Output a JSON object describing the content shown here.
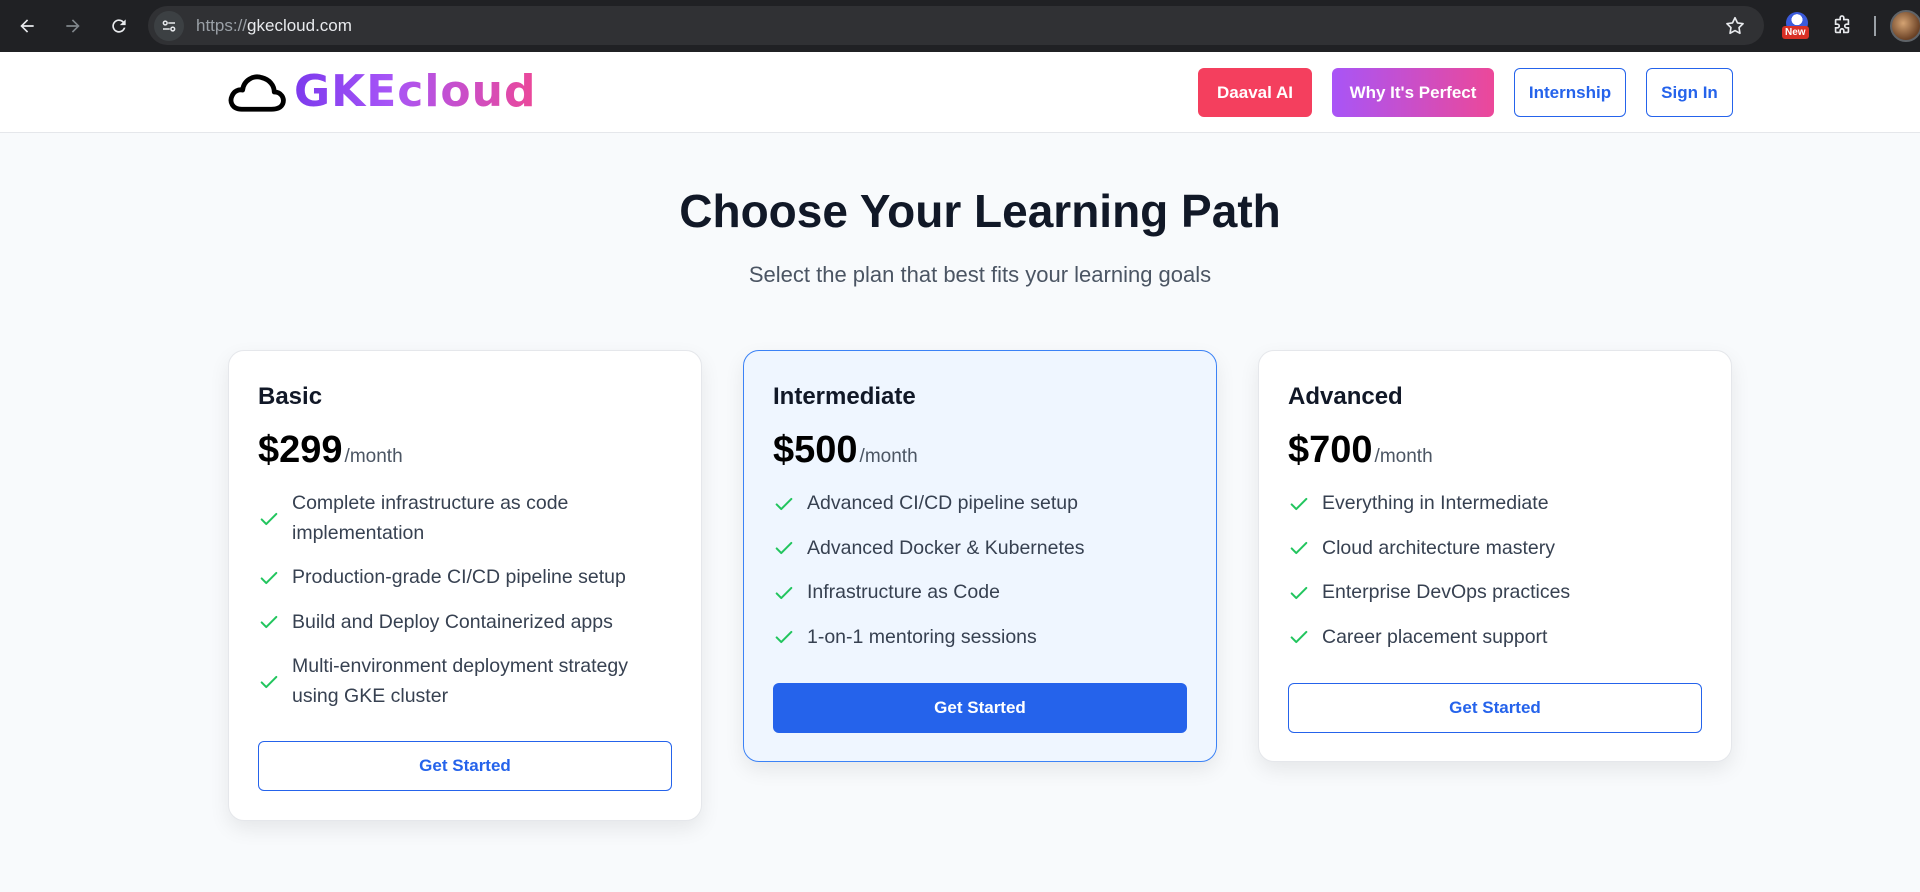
{
  "browser": {
    "url_scheme": "https://",
    "url_host": "gkecloud.com",
    "extension_badge": "New",
    "icons": [
      "back-arrow-icon",
      "forward-arrow-icon",
      "reload-icon",
      "site-settings-icon",
      "bookmark-star-icon",
      "extensions-puzzle-icon"
    ]
  },
  "header": {
    "logo_text": "GKEcloud",
    "buttons": {
      "daaval": "Daaval AI",
      "why": "Why It's Perfect",
      "internship": "Internship",
      "signin": "Sign In"
    }
  },
  "main": {
    "title": "Choose Your Learning Path",
    "subtitle": "Select the plan that best fits your learning goals"
  },
  "plans": [
    {
      "name": "Basic",
      "price": "$299",
      "period": "/month",
      "features": [
        "Complete infrastructure as code implementation",
        "Production-grade CI/CD pipeline setup",
        "Build and Deploy Containerized apps",
        "Multi-environment deployment strategy using GKE cluster"
      ],
      "cta": "Get Started"
    },
    {
      "name": "Intermediate",
      "price": "$500",
      "period": "/month",
      "features": [
        "Advanced CI/CD pipeline setup",
        "Advanced Docker & Kubernetes",
        "Infrastructure as Code",
        "1-on-1 mentoring sessions"
      ],
      "cta": "Get Started"
    },
    {
      "name": "Advanced",
      "price": "$700",
      "period": "/month",
      "features": [
        "Everything in Intermediate",
        "Cloud architecture mastery",
        "Enterprise DevOps practices",
        "Career placement support"
      ],
      "cta": "Get Started"
    }
  ],
  "colors": {
    "primary": "#2563eb",
    "check": "#22c55e",
    "daaval": "#f43f5e",
    "gradient_start": "#a855f7",
    "gradient_end": "#ec4899"
  }
}
